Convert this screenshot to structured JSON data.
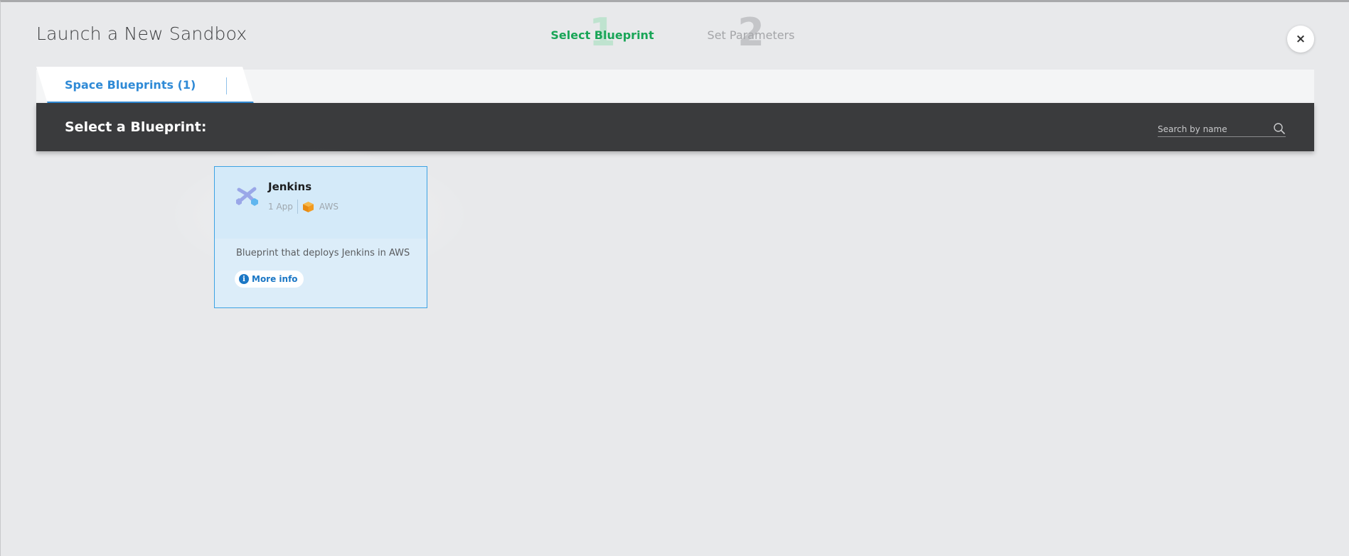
{
  "header": {
    "title": "Launch a New Sandbox",
    "close_icon": "×"
  },
  "wizard": {
    "steps": [
      {
        "number": "1",
        "label": "Select Blueprint",
        "state": "active"
      },
      {
        "number": "2",
        "label": "Set Parameters",
        "state": "inactive"
      }
    ]
  },
  "tabs": [
    {
      "label": "Space Blueprints (1)",
      "active": true
    }
  ],
  "blueprint_panel": {
    "heading": "Select a Blueprint:",
    "search_placeholder": "Search by name"
  },
  "cards": [
    {
      "title": "Jenkins",
      "apps": "1 App",
      "cloud": "AWS",
      "description": "Blueprint that deploys Jenkins in AWS",
      "more_info_label": "More info",
      "info_glyph": "i"
    }
  ],
  "colors": {
    "accent_blue": "#2f8ad6",
    "active_step_green": "#19a557",
    "dark_bar": "#3a3b3d",
    "card_border": "#3ca2e3",
    "aws_orange": "#f29a1f"
  }
}
